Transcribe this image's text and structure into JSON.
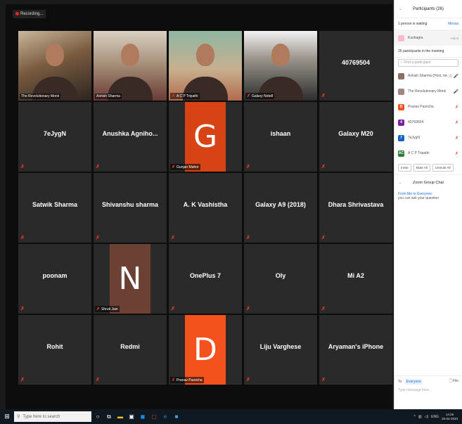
{
  "recording": {
    "label": "Recording..."
  },
  "tiles": [
    {
      "id": "revolutionary-monk",
      "type": "camera",
      "name": "The Revolutionary Monk",
      "active": true,
      "muted": false
    },
    {
      "id": "ashish-sharma",
      "type": "camera",
      "name": "Ashish Sharma",
      "muted": false
    },
    {
      "id": "acp-tripathi",
      "type": "camera",
      "name": "A C P Tripathi",
      "muted": true
    },
    {
      "id": "galaxy-note",
      "type": "camera",
      "name": "Galaxy Note8",
      "muted": true
    },
    {
      "id": "40769504",
      "type": "text",
      "label": "40769504"
    },
    {
      "id": "7eJygN",
      "type": "text",
      "label": "7eJygN"
    },
    {
      "id": "anushka",
      "type": "text",
      "label": "Anushka Agniho..."
    },
    {
      "id": "gunjan",
      "type": "avatar",
      "letter": "G",
      "color": "#d84315",
      "name": "Gunjan Mahor"
    },
    {
      "id": "ishaan",
      "type": "text",
      "label": "ishaan"
    },
    {
      "id": "galaxy-m20",
      "type": "text",
      "label": "Galaxy M20"
    },
    {
      "id": "satwik",
      "type": "text",
      "label": "Satwik Sharma"
    },
    {
      "id": "shivanshu",
      "type": "text",
      "label": "Shivanshu sharma"
    },
    {
      "id": "vashistha",
      "type": "text",
      "label": "A. K Vashistha"
    },
    {
      "id": "galaxy-a9",
      "type": "text",
      "label": "Galaxy A9 (2018)"
    },
    {
      "id": "dhara",
      "type": "text",
      "label": "Dhara Shrivastava"
    },
    {
      "id": "poonam",
      "type": "text",
      "label": "poonam"
    },
    {
      "id": "shruti",
      "type": "avatar",
      "letter": "N",
      "color": "#6d4034",
      "name": "Shruti Jain"
    },
    {
      "id": "oneplus7",
      "type": "text",
      "label": "OnePlus 7"
    },
    {
      "id": "oly",
      "type": "text",
      "label": "Oly"
    },
    {
      "id": "mi-a2",
      "type": "text",
      "label": "Mi A2"
    },
    {
      "id": "rohit",
      "type": "text",
      "label": "Rohit"
    },
    {
      "id": "redmi",
      "type": "text",
      "label": "Redmi"
    },
    {
      "id": "pranav",
      "type": "avatar",
      "letter": "D",
      "color": "#f4511e",
      "name": "Pranav Pasricha"
    },
    {
      "id": "lijju",
      "type": "text",
      "label": "Liju Varghese"
    },
    {
      "id": "aryaman",
      "type": "text",
      "label": "Aryaman's iPhone"
    }
  ],
  "panel": {
    "title": "Participants (26)",
    "waiting_label": "1 person is waiting",
    "message_all": "Messa",
    "waiting_person": "Kushagra",
    "admit": "Admit",
    "in_meeting_label": "25 participants in the meeting",
    "find_placeholder": "Find a participant",
    "participants": [
      {
        "name": "Ashish Sharma (Host, me)",
        "initial": "",
        "color": "#8d6e63",
        "icon": "⊙ 🎤"
      },
      {
        "name": "The Revolutionary Monk",
        "initial": "",
        "color": "#a1887f",
        "icon": "🎤"
      },
      {
        "name": "Pranav Pasricha",
        "initial": "D",
        "color": "#f4511e",
        "icon": "✗"
      },
      {
        "name": "40769504",
        "initial": "4",
        "color": "#7b1fa2",
        "icon": "✗"
      },
      {
        "name": "7eJygN",
        "initial": "7",
        "color": "#1565c0",
        "icon": "✗"
      },
      {
        "name": "A C P Tripathi",
        "initial": "AC",
        "color": "#2e7d32",
        "icon": "✗"
      }
    ],
    "buttons": [
      "Invite",
      "Mute All",
      "Unmute All"
    ],
    "chat_title": "Zoom Group Chat",
    "chat_from": "From Me to Everyone:",
    "chat_msg": "you can ask your question",
    "to_label": "To:",
    "to_value": "Everyone",
    "file_label": "File",
    "message_placeholder": "Type message here..."
  },
  "taskbar": {
    "search_placeholder": "Type here to search",
    "lang": "ENG",
    "time": "14:05",
    "date": "26-04-2020"
  }
}
